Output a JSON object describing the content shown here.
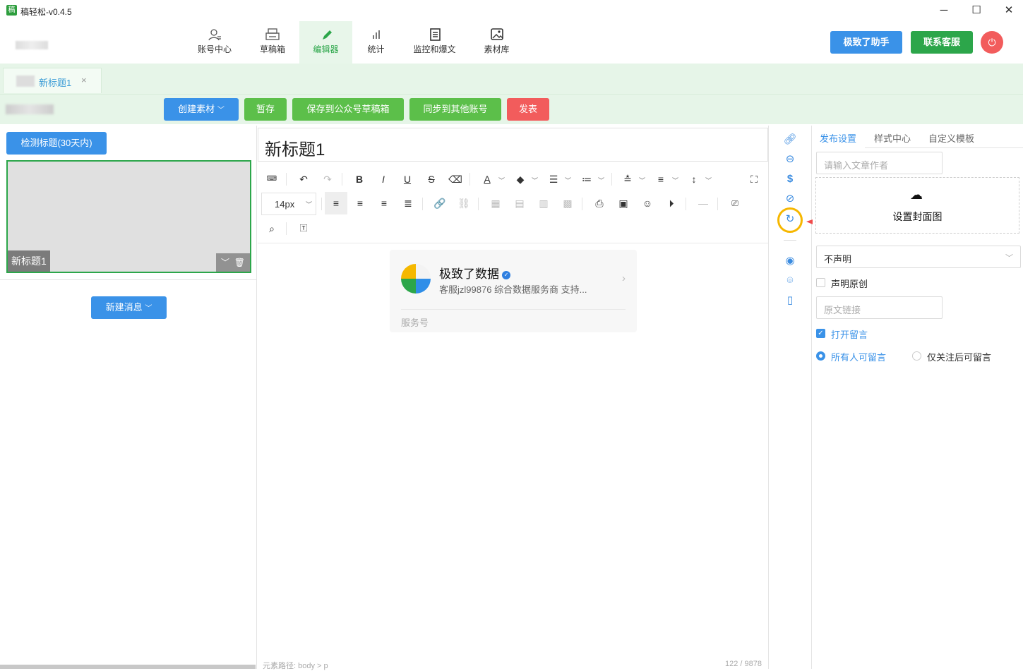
{
  "window": {
    "title": "稿轻松-v0.4.5",
    "logo_glyph": "稿"
  },
  "nav": {
    "items": [
      {
        "label": "账号中心",
        "icon": "user-icon"
      },
      {
        "label": "草稿箱",
        "icon": "printer-icon"
      },
      {
        "label": "编辑器",
        "icon": "pen-icon",
        "active": true
      },
      {
        "label": "统计",
        "icon": "bar-chart-icon"
      },
      {
        "label": "监控和爆文",
        "icon": "document-icon"
      },
      {
        "label": "素材库",
        "icon": "image-icon"
      }
    ]
  },
  "header_buttons": {
    "assistant": "极致了助手",
    "support": "联系客服"
  },
  "doc_tab": {
    "label": "新标题1",
    "close": "×"
  },
  "action_bar": {
    "create_material": "创建素材",
    "temp_save": "暂存",
    "save_draft": "保存到公众号草稿箱",
    "sync": "同步到其他账号",
    "publish": "发表"
  },
  "left": {
    "detect_title": "检测标题(30天内)",
    "thumb_title": "新标题1",
    "new_message": "新建消息"
  },
  "editor": {
    "title": "新标题1",
    "font_size": "14px",
    "card": {
      "name": "极致了数据",
      "description": "客服jzl99876 综合数据服务商 支持...",
      "type": "服务号"
    },
    "status_path": "元素路径: body > p",
    "char_count": "122 / 9878"
  },
  "right_panel": {
    "tabs": [
      "发布设置",
      "样式中心",
      "自定义模板"
    ],
    "author_placeholder": "请输入文章作者",
    "cover_label": "设置封面图",
    "declare_select": "不声明",
    "declare_original": "声明原创",
    "source_link_placeholder": "原文链接",
    "open_comments": "打开留言",
    "comment_all": "所有人可留言",
    "comment_followers": "仅关注后可留言"
  },
  "colors": {
    "green": "#2ca64a",
    "blue": "#3a92e8",
    "red": "#f25c5c",
    "highlight": "#f6b700",
    "arrow": "#f04b4b"
  }
}
